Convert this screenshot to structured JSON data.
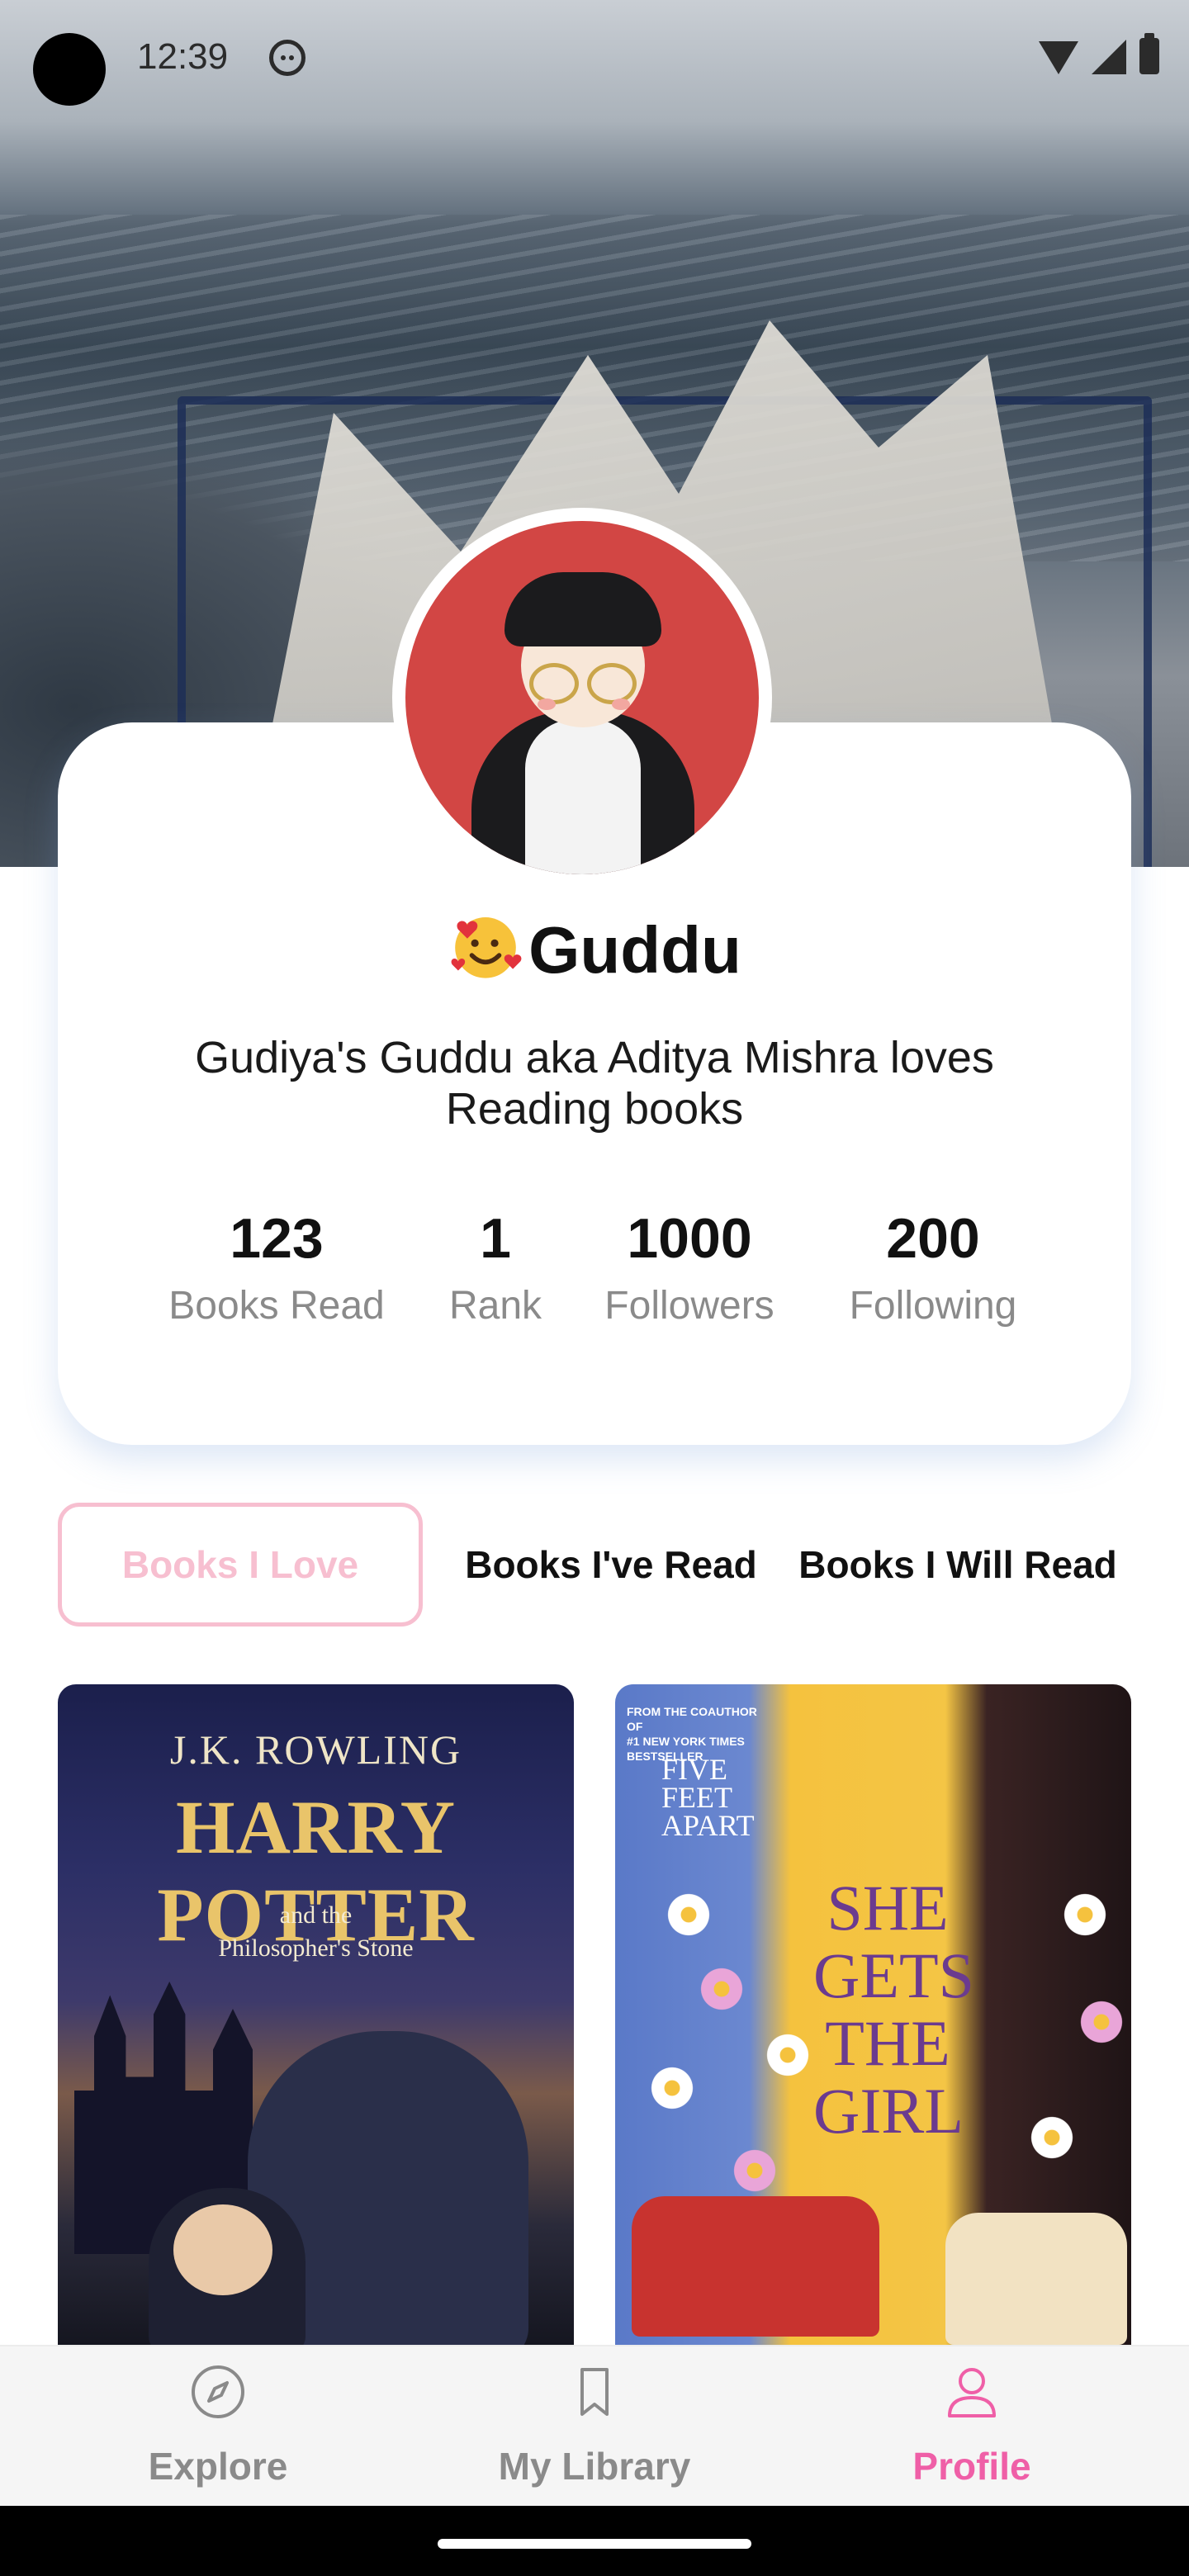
{
  "status_bar": {
    "time": "12:39"
  },
  "profile": {
    "name": "Guddu",
    "bio": "Gudiya's Guddu aka Aditya Mishra loves Reading books",
    "stats": [
      {
        "value": "123",
        "label": "Books Read"
      },
      {
        "value": "1",
        "label": "Rank"
      },
      {
        "value": "1000",
        "label": "Followers"
      },
      {
        "value": "200",
        "label": "Following"
      }
    ]
  },
  "tabs": [
    {
      "label": "Books I Love",
      "active": true
    },
    {
      "label": "Books I've Read",
      "active": false
    },
    {
      "label": "Books I Will Read",
      "active": false
    }
  ],
  "books": [
    {
      "author": "J.K. ROWLING",
      "title": "HARRY POTTER",
      "subtitle_line1": "and the",
      "subtitle_line2": "Philosopher's Stone"
    },
    {
      "tagline_line1": "FROM THE COAUTHOR OF",
      "tagline_line2": "#1 NEW YORK TIMES",
      "tagline_line3": "BESTSELLER",
      "related_line1": "FIVE",
      "related_line2": "FEET",
      "related_line3": "APART",
      "title_line1": "SHE",
      "title_line2": "GETS",
      "title_line3": "THE",
      "title_line4": "GIRL"
    }
  ],
  "bottom_nav": [
    {
      "label": "Explore",
      "icon": "compass-icon",
      "active": false
    },
    {
      "label": "My Library",
      "icon": "bookmark-icon",
      "active": false
    },
    {
      "label": "Profile",
      "icon": "person-icon",
      "active": true
    }
  ],
  "colors": {
    "accent_pink": "#ef5fa7",
    "tab_pink": "#f7bfd0",
    "muted_gray": "#8a8a8a"
  }
}
